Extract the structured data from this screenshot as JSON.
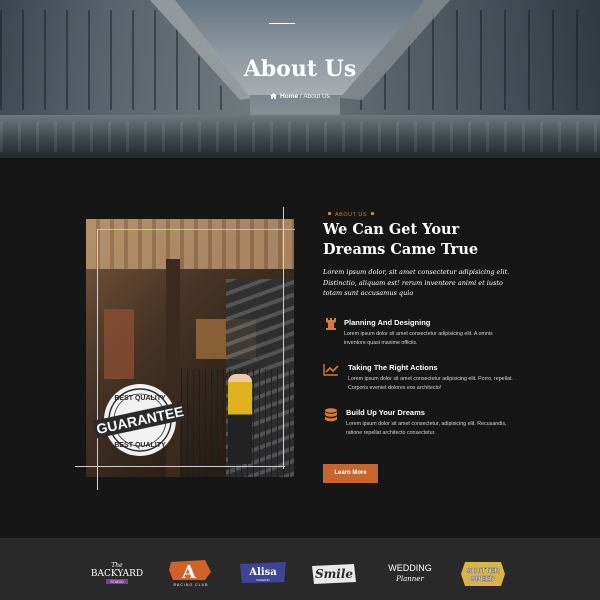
{
  "hero": {
    "title": "About Us",
    "breadcrumb": {
      "home": "Home",
      "separator": "/",
      "current": "About Us"
    }
  },
  "about": {
    "eyebrow": "ABOUT US",
    "heading": "We Can Get Your Dreams Came True",
    "lead": "Lorem ipsum dolor, sit amet consectetur adipisicing elit. Distinctio, aliquam est! rerum inventore animi et iusto totam sunt accusamus quia",
    "badge": {
      "top": "BEST QUALITY",
      "main": "GUARANTEE",
      "bottom": "BEST QUALITY"
    },
    "features": [
      {
        "icon": "chess-rook-icon",
        "title": "Planning And Designing",
        "desc": "Lorem ipsum dolor sit amet consectetur adipisicing elit. A omnis inventore quasi maxime officiis."
      },
      {
        "icon": "trend-chart-icon",
        "title": "Taking The Right Actions",
        "desc": "Lorem ipsum dolor sit amet consectetur adipisicing elit. Porro, repellat. Corporis eveniet dolores eos architecto!"
      },
      {
        "icon": "database-icon",
        "title": "Build Up Your Dreams",
        "desc": "Lorem ipsum dolor sit amet consectetur, adipisicing elit. Recusandis, ratione repellat architecto consectetur."
      }
    ],
    "button": "Learn More"
  },
  "logos": [
    {
      "name": "The Backyard",
      "l1": "The",
      "l2": "BACKYARD",
      "l3": "STUDIO"
    },
    {
      "name": "Racing Club",
      "l1": "A",
      "l2": "RACING CLUB"
    },
    {
      "name": "Alisa",
      "l1": "Alisa",
      "l2": "FASHION"
    },
    {
      "name": "Smile",
      "l1": "Smile"
    },
    {
      "name": "Wedding Planner",
      "l1": "WEDDING",
      "l2": "Planner"
    },
    {
      "name": "Shutter Speed",
      "l1": "SHUTTER",
      "l2": "SPEED"
    }
  ],
  "colors": {
    "accent": "#c6652c",
    "background": "#161616",
    "logo_bar": "#292929"
  }
}
